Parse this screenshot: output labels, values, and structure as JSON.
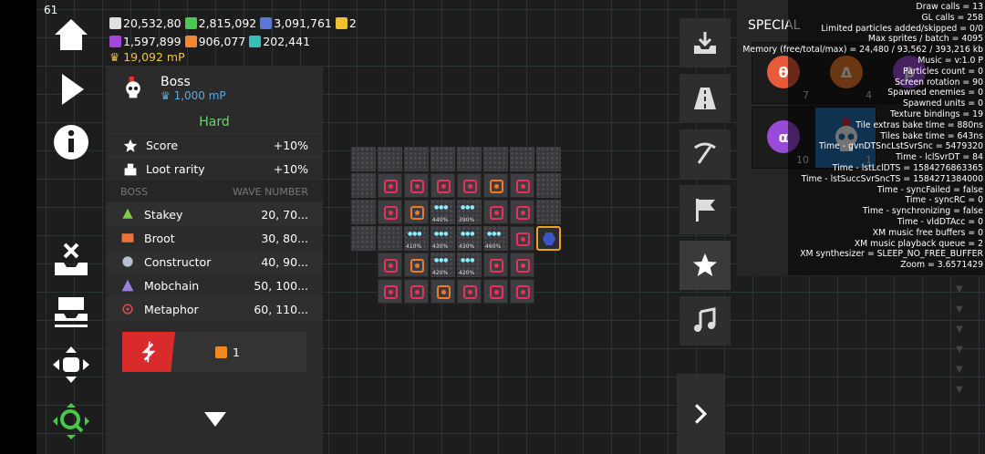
{
  "fps": "61",
  "resources": {
    "row1": [
      "20,532,80",
      "2,815,092",
      "3,091,761",
      "2"
    ],
    "row2": [
      "1,597,899",
      "906,077",
      "202,441"
    ],
    "mp": "19,092 mP"
  },
  "boss_panel": {
    "title": "Boss",
    "subtitle": "1,000 mP",
    "difficulty": "Hard",
    "stats": [
      {
        "label": "Score",
        "value": "+10%"
      },
      {
        "label": "Loot rarity",
        "value": "+10%"
      }
    ],
    "columns": {
      "boss": "BOSS",
      "wave": "WAVE NUMBER"
    },
    "bosses": [
      {
        "name": "Stakey",
        "waves": "20, 70...",
        "color": "#7ec850"
      },
      {
        "name": "Broot",
        "waves": "30, 80...",
        "color": "#e8743a"
      },
      {
        "name": "Constructor",
        "waves": "40, 90...",
        "color": "#b8c0d0"
      },
      {
        "name": "Mobchain",
        "waves": "50, 100...",
        "color": "#9a7ed8"
      },
      {
        "name": "Metaphor",
        "waves": "60, 110...",
        "color": "#d84a4a"
      }
    ],
    "reward_count": "1"
  },
  "special": {
    "title": "SPECIAL",
    "slots": [
      {
        "symbol": "θ",
        "count": "7",
        "color": "#e85a3a"
      },
      {
        "symbol": "Δ",
        "count": "4",
        "color": "#f07a2a"
      },
      {
        "symbol": "β",
        "count": "",
        "color": "#9a4ad8"
      },
      {
        "symbol": "α",
        "count": "10",
        "color": "#9a4ad8"
      },
      {
        "symbol": "",
        "count": "1",
        "color": "#1f6fb2"
      }
    ]
  },
  "debug_lines": [
    "Draw calls = 13",
    "GL calls = 258",
    "Limited particles added/skipped = 0/0",
    "Max sprites / batch = 4095",
    "Memory (free/total/max) = 24,480 / 93,562 / 393,216 kb",
    "Music = v:1.0 P",
    "Particles count = 0",
    "Screen rotation = 90",
    "Spawned enemies = 0",
    "Spawned units = 0",
    "Texture bindings = 19",
    "Tile extras bake time = 880ns",
    "Tiles bake time = 643ns",
    "Time - gvnDTSncLstSvrSnc = 5479320",
    "Time - lclSvrDT = 84",
    "Time - lstLclDTS = 1584276863365",
    "Time - lstSuccSvrSncTS = 1584271384000",
    "Time - syncFailed = false",
    "Time - syncRC = 0",
    "Time - synchronizing = false",
    "Time - vldDTAcc = 0",
    "XM music free buffers = 0",
    "XM music playback queue = 2",
    "XM synthesizer = SLEEP_NO_FREE_BUFFER",
    "Zoom = 3.6571429"
  ],
  "map": {
    "percent_labels": [
      "440%",
      "390%",
      "410%",
      "430%",
      "430%",
      "460%",
      "420%",
      "420%"
    ]
  }
}
